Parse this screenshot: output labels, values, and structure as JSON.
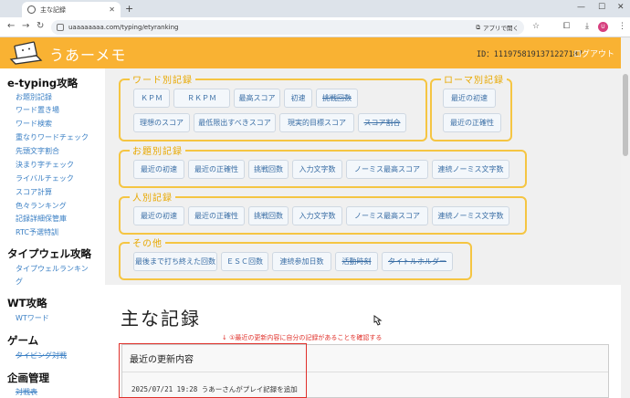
{
  "browser": {
    "tab_title": "主な記録",
    "url": "uaaaaaaaa.com/typing/etyranking",
    "open_in_app": "アプリで開く",
    "profile_initial": "U"
  },
  "header": {
    "brand": "うあーメモ",
    "user_id": "ID：1119758191371227187",
    "logout": "ログアウト"
  },
  "sidebar": {
    "sections": [
      {
        "title": "e-typing攻略",
        "items": [
          {
            "label": "お題別記録",
            "strike": false
          },
          {
            "label": "ワード置き場",
            "strike": false
          },
          {
            "label": "ワード検索",
            "strike": false
          },
          {
            "label": "重なりワードチェック",
            "strike": false
          },
          {
            "label": "先頭文字割合",
            "strike": false
          },
          {
            "label": "決まり字チェック",
            "strike": false
          },
          {
            "label": "ライバルチェック",
            "strike": false
          },
          {
            "label": "スコア計算",
            "strike": false
          },
          {
            "label": "色々ランキング",
            "strike": false
          },
          {
            "label": "記録詳細保管庫",
            "strike": false
          },
          {
            "label": "RTC予選特訓",
            "strike": false
          }
        ]
      },
      {
        "title": "タイプウェル攻略",
        "items": [
          {
            "label": "タイプウェルランキン",
            "strike": false
          },
          {
            "label": "グ",
            "strike": false
          }
        ]
      },
      {
        "title": "WT攻略",
        "items": [
          {
            "label": "WTワード",
            "strike": false
          }
        ]
      },
      {
        "title": "ゲーム",
        "items": [
          {
            "label": "タイピング対戦",
            "strike": true
          }
        ]
      },
      {
        "title": "企画管理",
        "items": [
          {
            "label": "対戦表",
            "strike": true
          }
        ]
      }
    ]
  },
  "panels": {
    "word": {
      "title": "ワード別記録",
      "buttons": [
        {
          "label": "ＫＰＭ",
          "strike": false
        },
        {
          "label": "ＲＫＰＭ",
          "strike": false
        },
        {
          "label": "最高スコア",
          "strike": false
        },
        {
          "label": "初速",
          "strike": false
        },
        {
          "label": "挑戦回数",
          "strike": true
        },
        {
          "label": "理想のスコア",
          "strike": false
        },
        {
          "label": "最低限出すべきスコア",
          "strike": false
        },
        {
          "label": "現実的目標スコア",
          "strike": false
        },
        {
          "label": "スコア割合",
          "strike": true
        }
      ]
    },
    "roma": {
      "title": "ローマ別記録",
      "buttons": [
        {
          "label": "最近の初速",
          "strike": false
        },
        {
          "label": "最近の正確性",
          "strike": false
        }
      ]
    },
    "topic": {
      "title": "お題別記録",
      "buttons": [
        {
          "label": "最近の初速",
          "strike": false
        },
        {
          "label": "最近の正確性",
          "strike": false
        },
        {
          "label": "挑戦回数",
          "strike": false
        },
        {
          "label": "入力文字数",
          "strike": false
        },
        {
          "label": "ノーミス最高スコア",
          "strike": false
        },
        {
          "label": "連続ノーミス文字数",
          "strike": false
        }
      ]
    },
    "person": {
      "title": "人別記録",
      "buttons": [
        {
          "label": "最近の初速",
          "strike": false
        },
        {
          "label": "最近の正確性",
          "strike": false
        },
        {
          "label": "挑戦回数",
          "strike": false
        },
        {
          "label": "入力文字数",
          "strike": false
        },
        {
          "label": "ノーミス最高スコア",
          "strike": false
        },
        {
          "label": "連続ノーミス文字数",
          "strike": false
        }
      ]
    },
    "other": {
      "title": "その他",
      "buttons": [
        {
          "label": "最後まで打ち終えた回数",
          "strike": false
        },
        {
          "label": "ＥＳＣ回数",
          "strike": false
        },
        {
          "label": "連続参加日数",
          "strike": false
        },
        {
          "label": "活動時刻",
          "strike": true
        },
        {
          "label": "タイトルホルダー",
          "strike": true
        }
      ]
    }
  },
  "content": {
    "title": "主な記録",
    "annotation": "↓ ①最近の更新内容に自分の記録があることを確認する",
    "card_header": "最近の更新内容",
    "card_text": "2025/07/21 19:28 うあーさんがプレイ記録を追加"
  }
}
